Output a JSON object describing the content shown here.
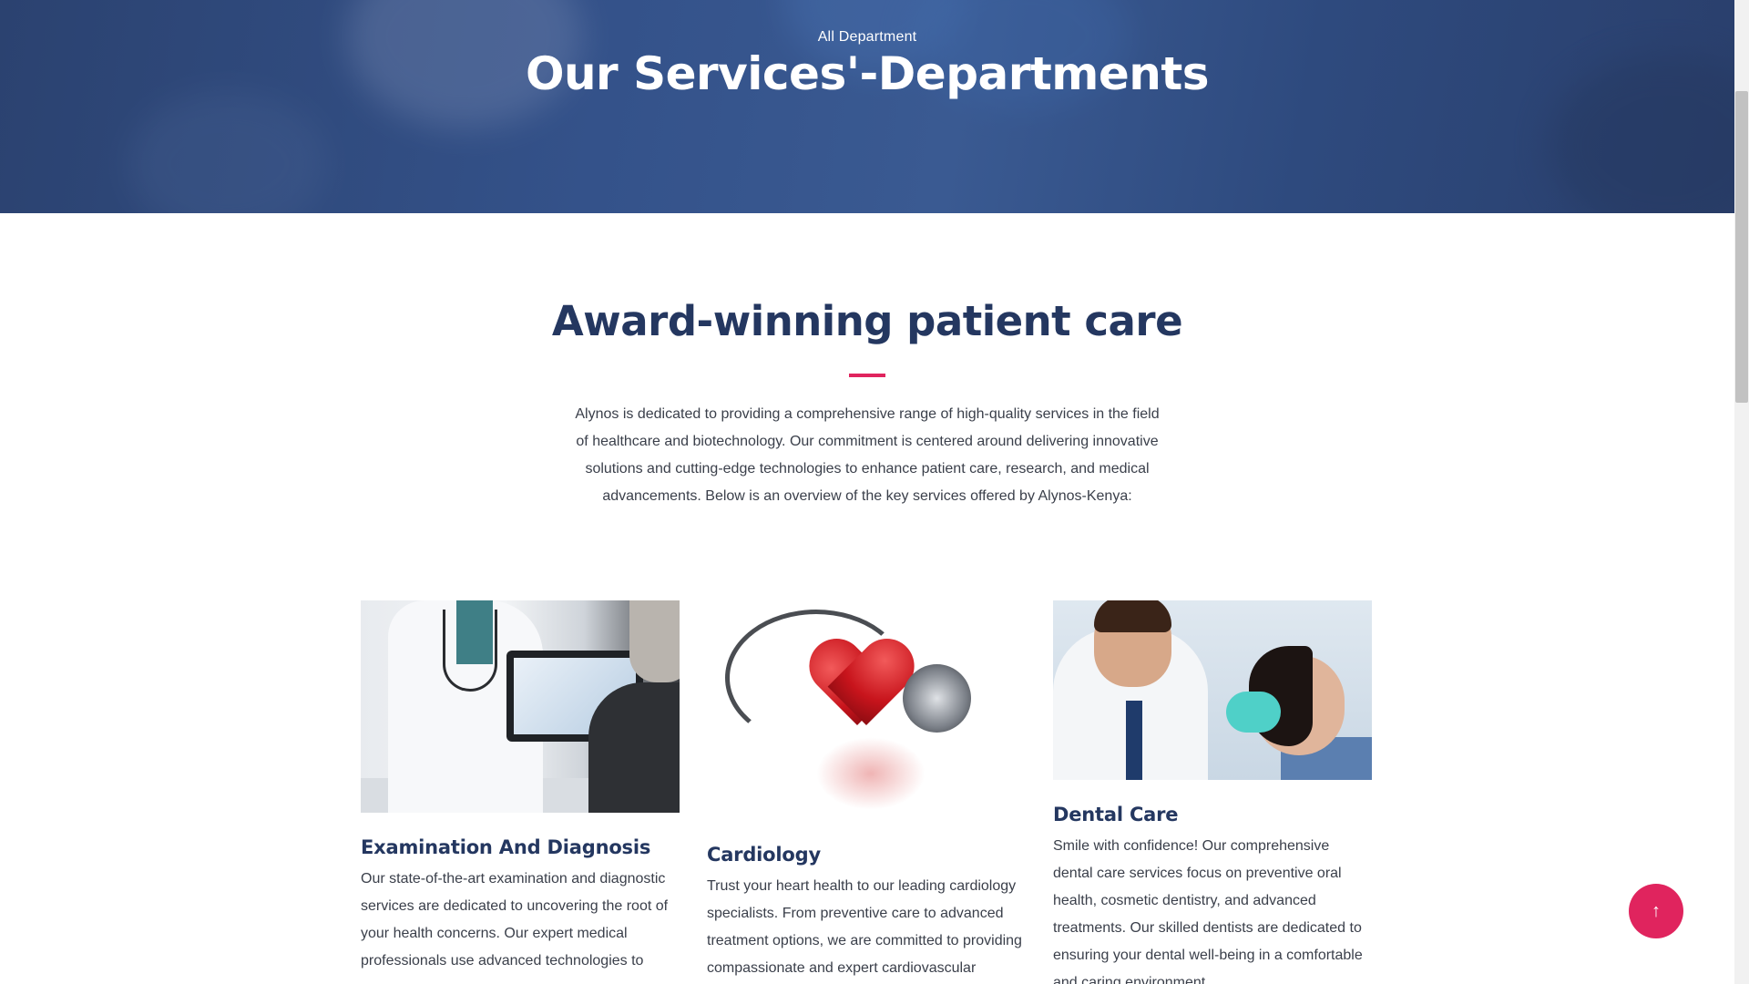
{
  "hero": {
    "subtitle": "All Department",
    "title": "Our Services'-Departments"
  },
  "intro": {
    "title": "Award-winning patient care",
    "text": "Alynos is dedicated to providing a comprehensive range of high-quality services in the field of healthcare and biotechnology. Our commitment is centered around delivering innovative solutions and cutting-edge technologies to enhance patient care, research, and medical advancements. Below is an overview of the key services offered by Alynos-Kenya:"
  },
  "services": [
    {
      "title": "Examination And Diagnosis",
      "text": "Our state-of-the-art examination and diagnostic services are dedicated to uncovering the root of your health concerns. Our expert medical professionals use advanced technologies to"
    },
    {
      "title": "Cardiology",
      "text": "Trust your heart health to our leading cardiology specialists. From preventive care to advanced treatment options, we are committed to providing compassionate and expert cardiovascular"
    },
    {
      "title": "Dental Care",
      "text": "Smile with confidence! Our comprehensive dental care services focus on preventive oral health, cosmetic dentistry, and advanced treatments. Our skilled dentists are dedicated to ensuring your dental well-being in a comfortable and caring environment."
    }
  ],
  "back_to_top": {
    "label": "↑"
  },
  "colors": {
    "accent": "#e0245e",
    "heading": "#243760",
    "hero_bg": "#34528a"
  }
}
